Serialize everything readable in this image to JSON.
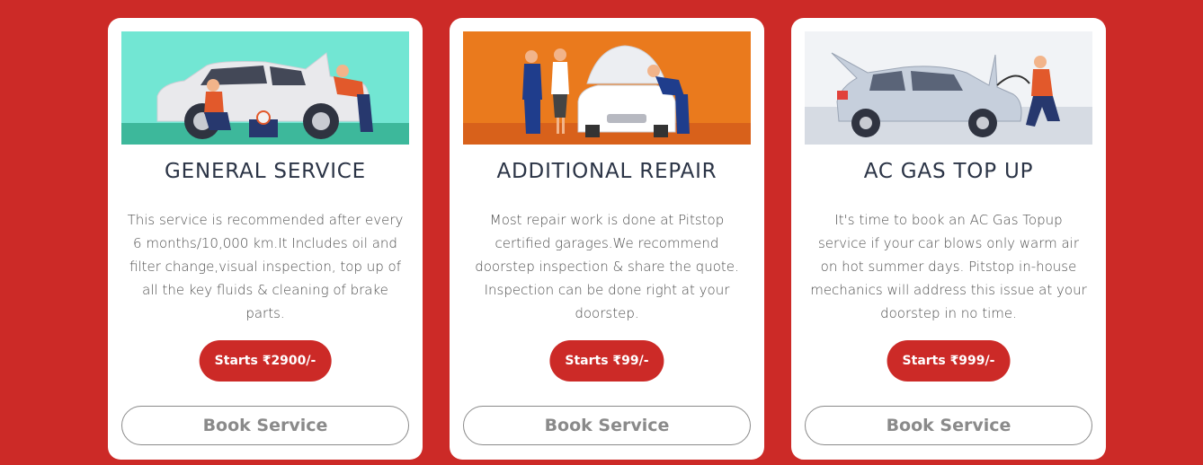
{
  "cards": [
    {
      "title": "GENERAL SERVICE",
      "description": "This service is recommended after every 6 months/10,000 km.It Includes oil and filter change,visual inspection, top up of all the key fluids & cleaning of brake parts.",
      "price_label": "Starts ₹2900/-",
      "book_label": "Book Service",
      "illustration": "mechanics-servicing-car"
    },
    {
      "title": "ADDITIONAL REPAIR",
      "description": "Most repair work is done at Pitstop certified garages.We recommend doorstep inspection & share the quote. Inspection can be done right at your doorstep.",
      "price_label": "Starts ₹99/-",
      "book_label": "Book Service",
      "illustration": "mechanic-inspecting-car-with-customer"
    },
    {
      "title": "AC GAS TOP UP",
      "description": "It's time to book an AC Gas Topup service if your car blows only warm air on hot summer days. Pitstop in-house mechanics will address this issue at your doorstep in no time.",
      "price_label": "Starts ₹999/-",
      "book_label": "Book Service",
      "illustration": "mechanic-refilling-ac-gas"
    }
  ],
  "colors": {
    "background": "#cc2a27",
    "accent": "#cc2a27",
    "card": "#ffffff",
    "title": "#2b3446",
    "button_outline": "#8a8a8a"
  }
}
